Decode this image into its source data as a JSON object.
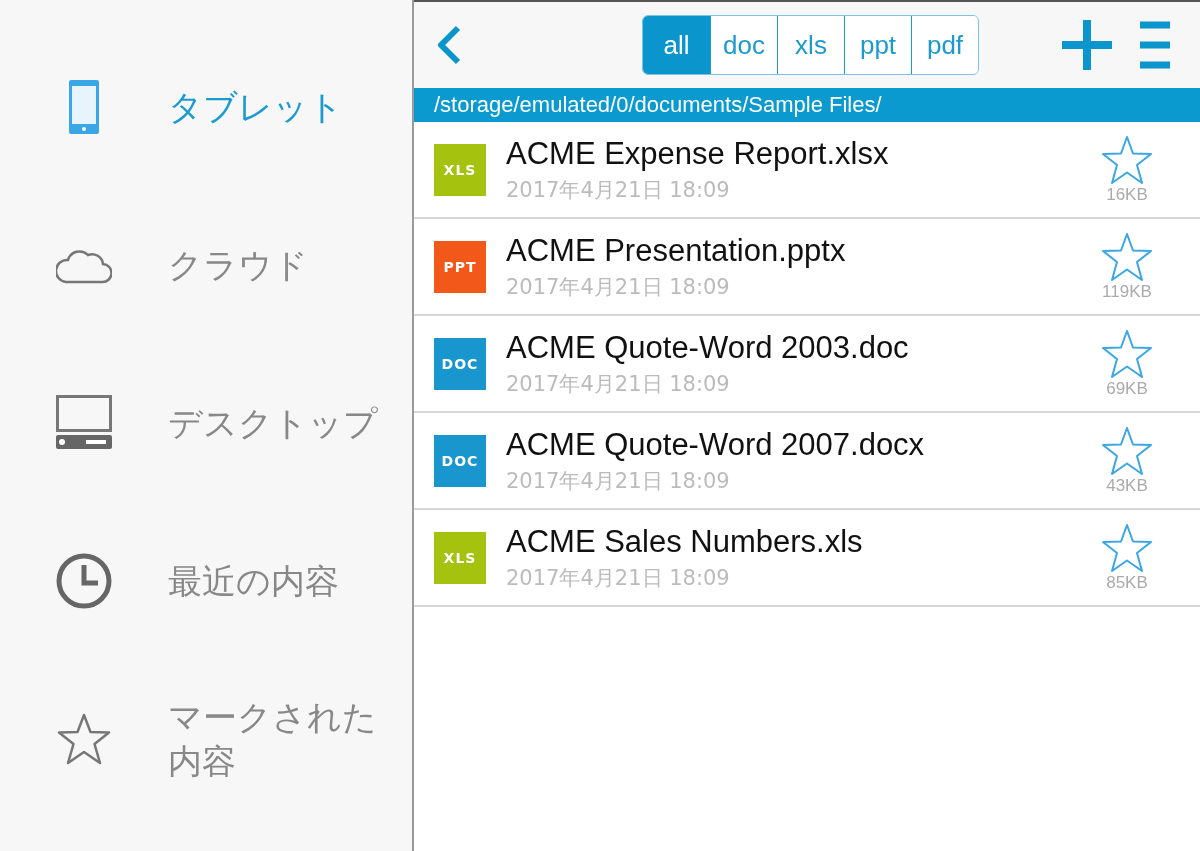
{
  "sidebar": {
    "items": [
      {
        "label": "タブレット",
        "kind": "tablet",
        "selected": true
      },
      {
        "label": "クラウド",
        "kind": "cloud",
        "selected": false
      },
      {
        "label": "デスクトップ",
        "kind": "desktop",
        "selected": false
      },
      {
        "label": "最近の内容",
        "kind": "recent",
        "selected": false
      },
      {
        "label": "マークされた内容",
        "kind": "starred",
        "selected": false
      }
    ]
  },
  "filters": [
    {
      "label": "all",
      "selected": true
    },
    {
      "label": "doc",
      "selected": false
    },
    {
      "label": "xls",
      "selected": false
    },
    {
      "label": "ppt",
      "selected": false
    },
    {
      "label": "pdf",
      "selected": false
    }
  ],
  "path": "/storage/emulated/0/documents/Sample Files/",
  "files": [
    {
      "badge": "XLS",
      "color": "#a4c20e",
      "name": "ACME Expense Report.xlsx",
      "date": "2017年4月21日 18:09",
      "size": "16KB",
      "starred": false
    },
    {
      "badge": "PPT",
      "color": "#f2581a",
      "name": "ACME Presentation.pptx",
      "date": "2017年4月21日 18:09",
      "size": "119KB",
      "starred": false
    },
    {
      "badge": "DOC",
      "color": "#1a96cf",
      "name": "ACME Quote-Word 2003.doc",
      "date": "2017年4月21日 18:09",
      "size": "69KB",
      "starred": false
    },
    {
      "badge": "DOC",
      "color": "#1a96cf",
      "name": "ACME Quote-Word 2007.docx",
      "date": "2017年4月21日 18:09",
      "size": "43KB",
      "starred": false
    },
    {
      "badge": "XLS",
      "color": "#a4c20e",
      "name": "ACME Sales Numbers.xls",
      "date": "2017年4月21日 18:09",
      "size": "85KB",
      "starred": false
    }
  ]
}
